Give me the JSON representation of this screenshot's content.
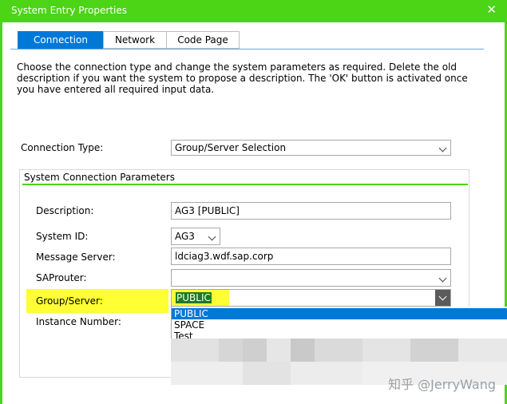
{
  "window": {
    "title": "System Entry Properties"
  },
  "tabs": [
    {
      "label": "Connection",
      "active": true
    },
    {
      "label": "Network",
      "active": false
    },
    {
      "label": "Code Page",
      "active": false
    }
  ],
  "description_text": "Choose the connection type and change the system parameters as required. Delete the old description if you want the system to propose a description. The 'OK' button is activated once you have entered all required input data.",
  "connection_type": {
    "label": "Connection Type:",
    "value": "Group/Server Selection"
  },
  "group": {
    "title": "System Connection Parameters",
    "description": {
      "label": "Description:",
      "value": "AG3 [PUBLIC]"
    },
    "system_id": {
      "label": "System ID:",
      "value": "AG3"
    },
    "message_server": {
      "label": "Message Server:",
      "value": "ldciag3.wdf.sap.corp"
    },
    "saprouter": {
      "label": "SAProuter:",
      "value": ""
    },
    "group_server": {
      "label": "Group/Server:",
      "value": "PUBLIC",
      "options": [
        "PUBLIC",
        "SPACE",
        "Test"
      ]
    },
    "instance_number": {
      "label": "Instance Number:"
    }
  },
  "watermark": "知乎 @JerryWang",
  "colors": {
    "titlebar": "#4cd417",
    "accent": "#0078d7",
    "highlight": "#ffff33"
  }
}
